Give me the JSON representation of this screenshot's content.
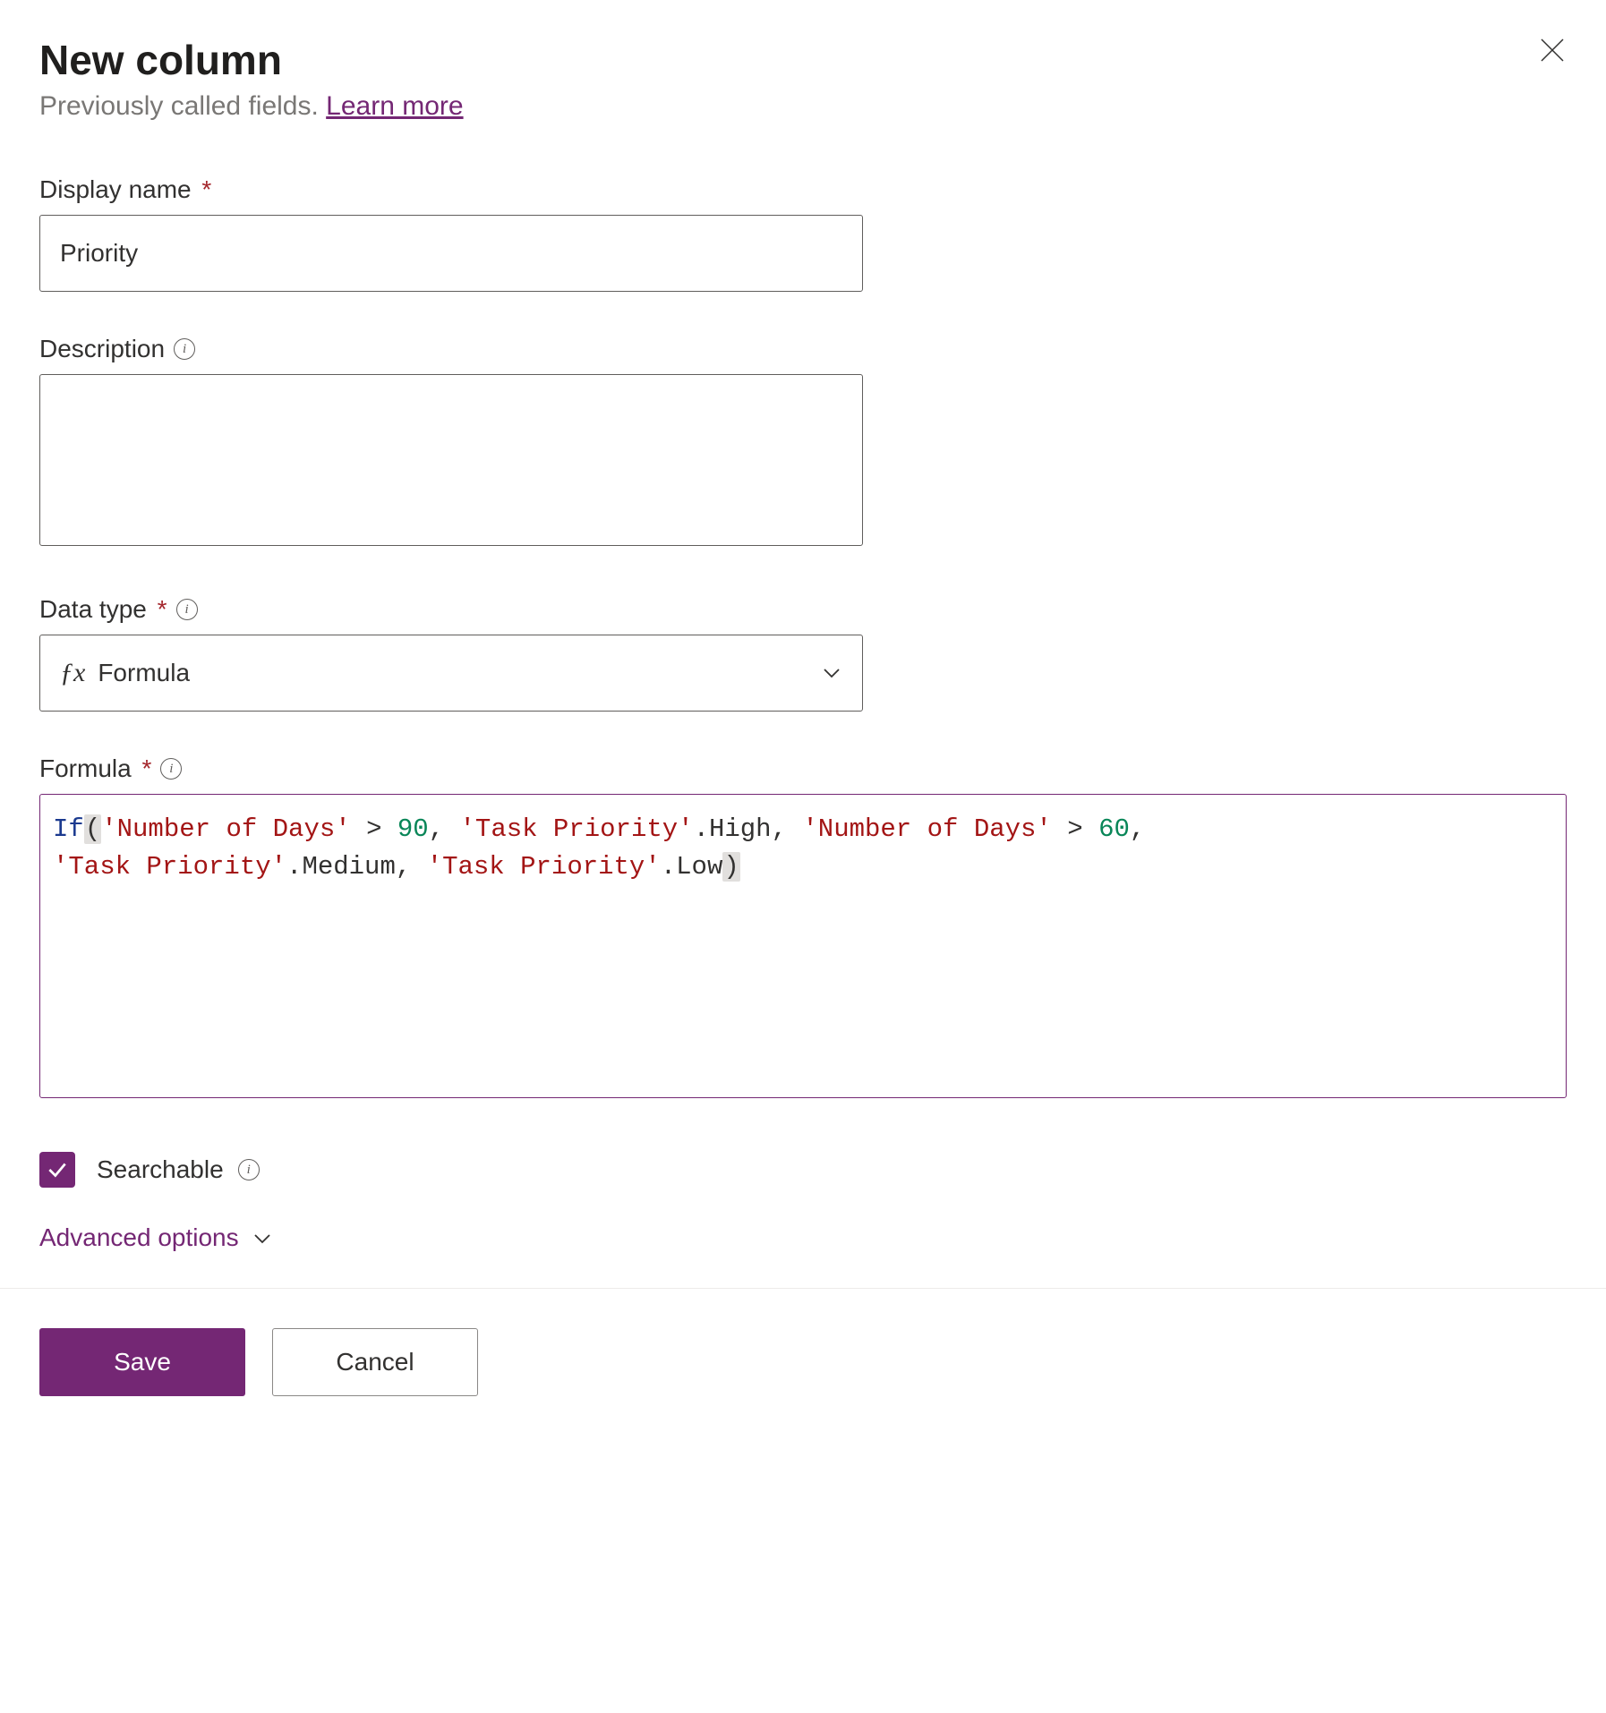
{
  "header": {
    "title": "New column",
    "subtitle_text": "Previously called fields. ",
    "learn_more": "Learn more"
  },
  "fields": {
    "display_name": {
      "label": "Display name",
      "value": "Priority"
    },
    "description": {
      "label": "Description",
      "value": ""
    },
    "data_type": {
      "label": "Data type",
      "value": "Formula"
    },
    "formula": {
      "label": "Formula",
      "tokens": {
        "if": "If",
        "lparen": "(",
        "str_numdays": "'Number of Days'",
        "gt": " > ",
        "n90": "90",
        "comma": ", ",
        "str_taskprio": "'Task Priority'",
        "dot_high": ".High",
        "n60": "60",
        "dot_medium": ".Medium",
        "dot_low": ".Low",
        "rparen": ")"
      }
    },
    "searchable": {
      "label": "Searchable"
    },
    "advanced": {
      "label": "Advanced options"
    }
  },
  "buttons": {
    "save": "Save",
    "cancel": "Cancel"
  }
}
